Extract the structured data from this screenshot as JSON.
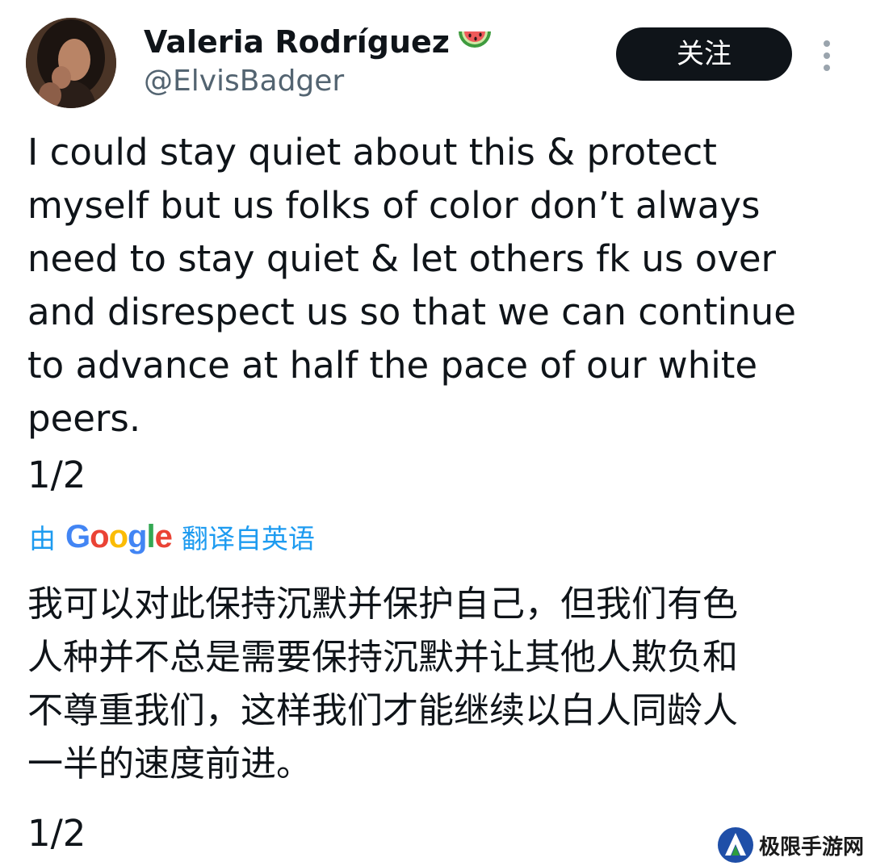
{
  "user": {
    "display_name": "Valeria Rodríguez",
    "display_emoji": "watermelon-icon",
    "handle": "@ElvisBadger"
  },
  "actions": {
    "follow_label": "关注",
    "more_icon": "more-vertical-icon"
  },
  "tweet": {
    "text": "I could stay quiet about this & protect\nmyself but us folks of color don’t always\nneed to stay quiet & let others fk us over\nand disrespect us so that we can continue\nto advance at half the pace of our white\npeers.",
    "counter": "1/2"
  },
  "translation": {
    "prefix": "由",
    "provider": "Google",
    "suffix": "翻译自英语",
    "text": "我可以对此保持沉默并保护自己，但我们有色\n人种并不总是需要保持沉默并让其他人欺负和\n不尊重我们，这样我们才能继续以白人同龄人\n一半的速度前进。",
    "counter": "1/2"
  },
  "watermark": {
    "text": "极限手游网",
    "colors": {
      "blue": "#1f4fa8",
      "green": "#2e9e3e"
    }
  },
  "colors": {
    "text": "#0f1419",
    "secondary": "#536471",
    "link": "#1d9bf0",
    "button_bg": "#0f1419",
    "button_text": "#ffffff",
    "google_blue": "#4285f4",
    "google_red": "#ea4335",
    "google_yellow": "#fbbc05",
    "google_green": "#34a853"
  }
}
